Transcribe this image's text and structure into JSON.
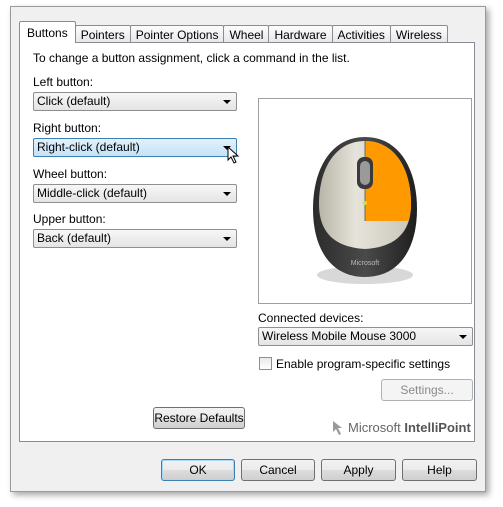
{
  "tabs": [
    "Buttons",
    "Pointers",
    "Pointer Options",
    "Wheel",
    "Hardware",
    "Activities",
    "Wireless"
  ],
  "instruction": "To change a button assignment, click a command in the list.",
  "left_button": {
    "label": "Left button:",
    "value": "Click (default)"
  },
  "right_button": {
    "label": "Right button:",
    "value": "Right-click (default)"
  },
  "wheel_button": {
    "label": "Wheel button:",
    "value": "Middle-click (default)"
  },
  "upper_button": {
    "label": "Upper button:",
    "value": "Back (default)"
  },
  "mouse_preview": {
    "highlight_color": "#ff9900",
    "brand_text": "Microsoft"
  },
  "connected_devices": {
    "label": "Connected devices:",
    "value": "Wireless Mobile Mouse 3000"
  },
  "program_specific": {
    "label": "Enable program-specific settings",
    "checked": false
  },
  "settings_button": "Settings...",
  "restore_defaults_button": "Restore Defaults",
  "brand": {
    "company": "Microsoft",
    "product": "IntelliPoint"
  },
  "footer": {
    "ok": "OK",
    "cancel": "Cancel",
    "apply": "Apply",
    "help": "Help"
  }
}
